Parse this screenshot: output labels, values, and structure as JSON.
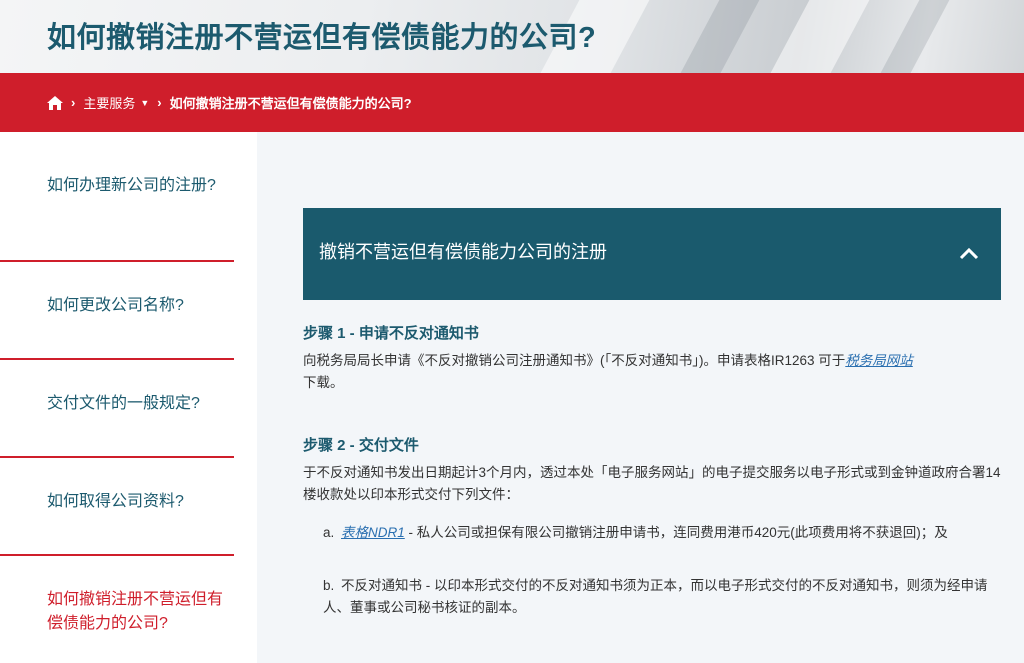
{
  "hero": {
    "title": "如何撤销注册不营运但有偿债能力的公司?"
  },
  "breadcrumb": {
    "home_icon": "home-icon",
    "item1": "主要服务",
    "current": "如何撤销注册不营运但有偿债能力的公司?"
  },
  "sidebar": {
    "items": [
      {
        "label": "如何办理新公司的注册?"
      },
      {
        "label": "如何更改公司名称?"
      },
      {
        "label": "交付文件的一般规定?"
      },
      {
        "label": "如何取得公司资料?"
      },
      {
        "label": "如何撤销注册不营运但有偿债能力的公司?"
      }
    ]
  },
  "accordion": {
    "title": "撤销不营运但有偿债能力公司的注册",
    "toggle_icon": "chevron-up-icon"
  },
  "step1": {
    "heading": "步骤 1 - 申请不反对通知书",
    "text_a": "向税务局局长申请《不反对撤销公司注册通知书》(「不反对通知书」)。申请表格IR1263 可于",
    "link": "税务局网站",
    "text_b": "下载。"
  },
  "step2": {
    "heading": "步骤 2 - 交付文件",
    "text": "于不反对通知书发出日期起计3个月内，透过本处「电子服务网站」的电子提交服务以电子形式或到金钟道政府合署14楼收款处以印本形式交付下列文件：",
    "items": [
      {
        "mark": "a.",
        "link": "表格NDR1",
        "text": " - 私人公司或担保有限公司撤销注册申请书，连同费用港币420元(此项费用将不获退回)；及"
      },
      {
        "mark": "b.",
        "text": "不反对通知书 - 以印本形式交付的不反对通知书须为正本，而以电子形式交付的不反对通知书，则须为经申请人、董事或公司秘书核证的副本。"
      }
    ]
  },
  "colors": {
    "brand_red": "#cf1e2b",
    "teal": "#1a5a6d",
    "link": "#2a6fb0"
  }
}
